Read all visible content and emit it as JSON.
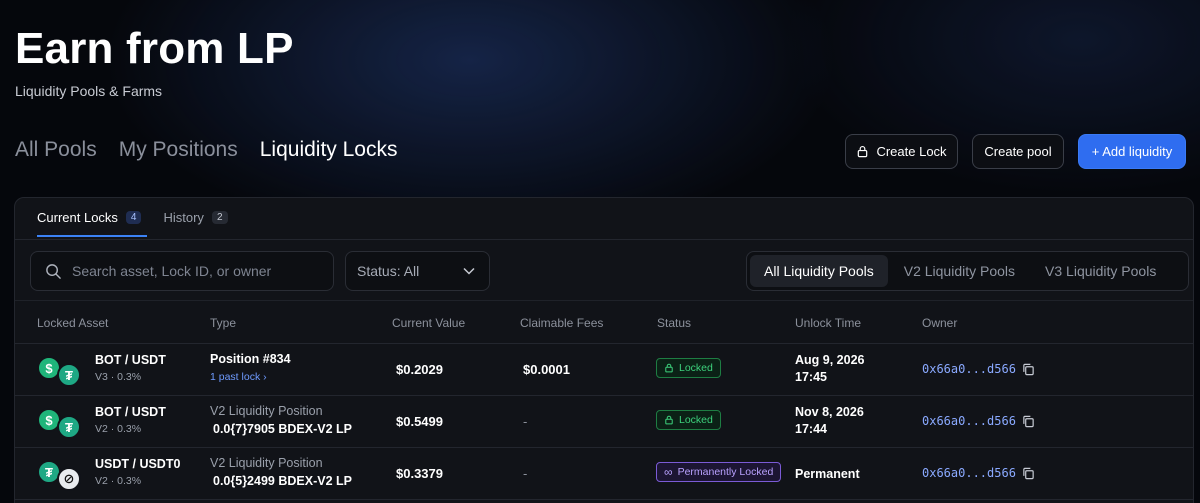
{
  "header": {
    "title": "Earn from LP",
    "subtitle": "Liquidity Pools & Farms"
  },
  "main_tabs": [
    {
      "label": "All Pools",
      "active": false
    },
    {
      "label": "My Positions",
      "active": false
    },
    {
      "label": "Liquidity Locks",
      "active": true
    }
  ],
  "actions": {
    "create_lock": "Create Lock",
    "create_pool": "Create pool",
    "add_liquidity": "+ Add liquidity"
  },
  "sub_tabs": [
    {
      "label": "Current Locks",
      "count": "4",
      "active": true
    },
    {
      "label": "History",
      "count": "2",
      "active": false
    }
  ],
  "search": {
    "placeholder": "Search asset, Lock ID, or owner",
    "value": ""
  },
  "status_filter": {
    "label": "Status: All"
  },
  "pool_filter": [
    {
      "label": "All Liquidity Pools",
      "active": true
    },
    {
      "label": "V2 Liquidity Pools",
      "active": false
    },
    {
      "label": "V3 Liquidity Pools",
      "active": false
    }
  ],
  "table": {
    "headers": [
      "Locked Asset",
      "Type",
      "Current Value",
      "Claimable Fees",
      "Status",
      "Unlock Time",
      "Owner"
    ],
    "rows": [
      {
        "pair": "BOT / USDT",
        "fee": "V3 · 0.3%",
        "type": "Position #834",
        "type_sub": "1 past lock  ›",
        "value": "$0.2029",
        "fees": "$0.0001",
        "status": "Locked",
        "unlock_date": "Aug 9, 2026",
        "unlock_time": "17:45",
        "owner": "0x66a0...d566"
      },
      {
        "pair": "BOT / USDT",
        "fee": "V2 · 0.3%",
        "type": "V2 Liquidity Position",
        "type_sub": "0.0{7}7905  BDEX-V2 LP",
        "value": "$0.5499",
        "fees": "-",
        "status": "Locked",
        "unlock_date": "Nov 8, 2026",
        "unlock_time": "17:44",
        "owner": "0x66a0...d566"
      },
      {
        "pair": "USDT / USDT0",
        "fee": "V2 · 0.3%",
        "type": "V2 Liquidity Position",
        "type_sub": "0.0{5}2499  BDEX-V2 LP",
        "value": "$0.3379",
        "fees": "-",
        "status": "Permanently Locked",
        "unlock_date": "Permanent",
        "unlock_time": "",
        "owner": "0x66a0...d566"
      }
    ]
  },
  "colors": {
    "accent": "#2f6df0",
    "locked": "#3dd17c",
    "permanent": "#b9a1ff",
    "owner_link": "#8aa9ff"
  },
  "icons": {
    "lock": "lock-icon",
    "search": "search-icon",
    "chevron": "chevron-down-icon",
    "copy": "copy-icon",
    "infinity": "infinity-icon"
  }
}
